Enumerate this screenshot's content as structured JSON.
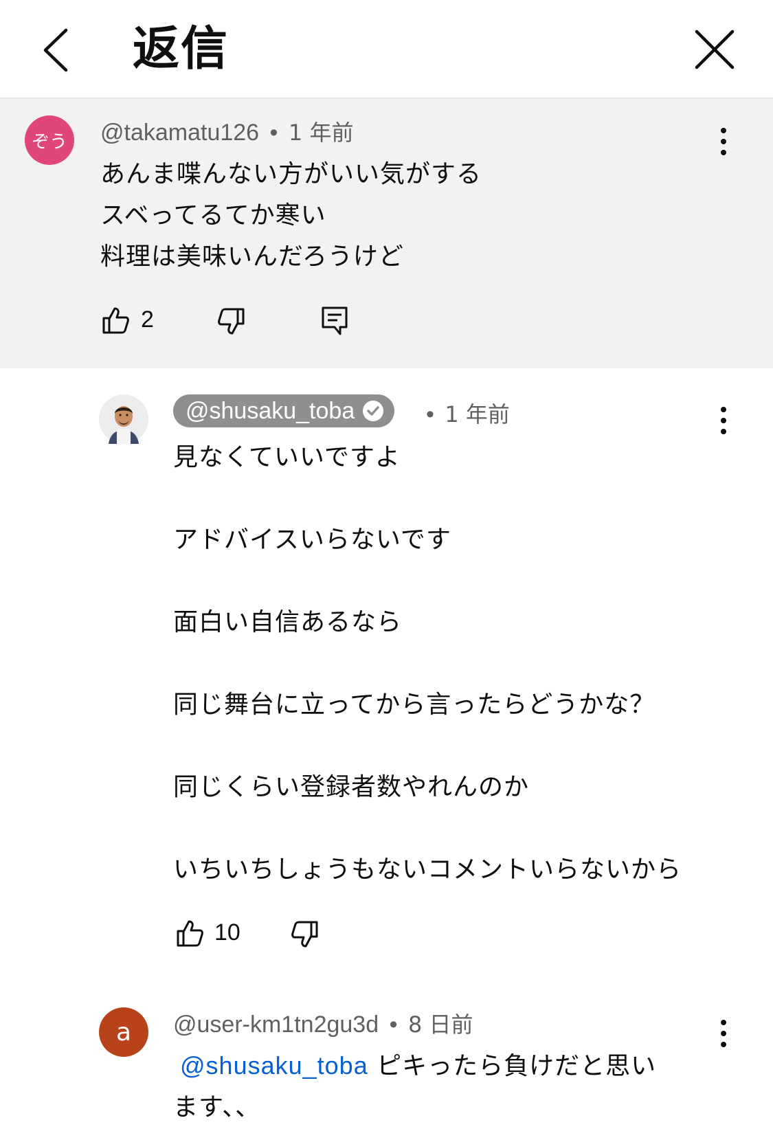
{
  "header": {
    "title": "返信",
    "back_icon": "chevron-left-icon",
    "close_icon": "close-icon"
  },
  "colors": {
    "highlight_bg": "#f2f2f2",
    "mention": "#065fd4",
    "avatar_pink": "#e0457b",
    "avatar_brown": "#b8421a",
    "chip_bg": "#8f8f8f"
  },
  "parent_comment": {
    "avatar_text": "ぞう",
    "handle": "@takamatu126",
    "separator": "•",
    "time": "1 年前",
    "lines": [
      "あんま喋んない方がいい気がする",
      "スベってるてか寒い",
      "料理は美味いんだろうけど"
    ],
    "likes": "2"
  },
  "replies": [
    {
      "handle": "@shusaku_toba",
      "verified": true,
      "separator": "•",
      "time": "1 年前",
      "lines": [
        "見なくていいですよ",
        "アドバイスいらないです",
        "面白い自信あるなら",
        "同じ舞台に立ってから言ったらどうかな？",
        "同じくらい登録者数やれんのか",
        "いちいちしょうもないコメントいらないから"
      ],
      "likes": "10"
    },
    {
      "avatar_text": "a",
      "handle": "@user-km1tn2gu3d",
      "separator": "•",
      "time": "8 日前",
      "mention": "@shusaku_toba",
      "line1_rest": " ピキったら負けだと思い",
      "line2": "ます、、"
    }
  ]
}
